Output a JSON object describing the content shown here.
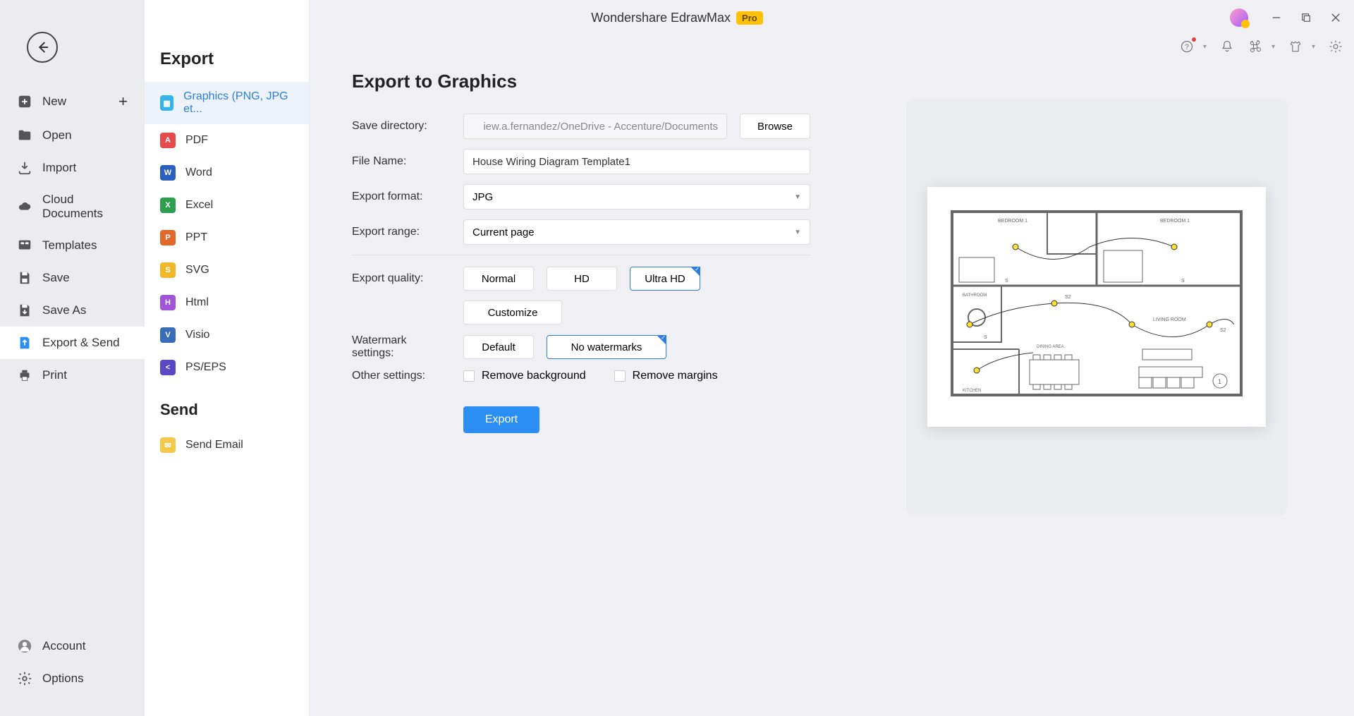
{
  "titlebar": {
    "title": "Wondershare EdrawMax",
    "badge": "Pro"
  },
  "nav": {
    "items": [
      {
        "label": "New",
        "has_plus": true
      },
      {
        "label": "Open"
      },
      {
        "label": "Import"
      },
      {
        "label": "Cloud Documents"
      },
      {
        "label": "Templates"
      },
      {
        "label": "Save"
      },
      {
        "label": "Save As"
      },
      {
        "label": "Export & Send"
      },
      {
        "label": "Print"
      }
    ],
    "bottom": [
      {
        "label": "Account"
      },
      {
        "label": "Options"
      }
    ]
  },
  "exportcol": {
    "heading_export": "Export",
    "heading_send": "Send",
    "items": [
      {
        "label": "Graphics (PNG, JPG et..."
      },
      {
        "label": "PDF"
      },
      {
        "label": "Word"
      },
      {
        "label": "Excel"
      },
      {
        "label": "PPT"
      },
      {
        "label": "SVG"
      },
      {
        "label": "Html"
      },
      {
        "label": "Visio"
      },
      {
        "label": "PS/EPS"
      }
    ],
    "send_items": [
      {
        "label": "Send Email"
      }
    ]
  },
  "form": {
    "heading": "Export to Graphics",
    "labels": {
      "save_dir": "Save directory:",
      "file_name": "File Name:",
      "format": "Export format:",
      "range": "Export range:",
      "quality": "Export quality:",
      "watermark": "Watermark settings:",
      "other": "Other settings:"
    },
    "save_dir_value": "iew.a.fernandez/OneDrive - Accenture/Documents",
    "browse": "Browse",
    "file_name_value": "House Wiring Diagram Template1",
    "format_value": "JPG",
    "range_value": "Current page",
    "quality_options": {
      "normal": "Normal",
      "hd": "HD",
      "ultra": "Ultra HD",
      "custom": "Customize"
    },
    "watermark_options": {
      "default": "Default",
      "none": "No watermarks"
    },
    "other_options": {
      "remove_bg": "Remove background",
      "remove_margins": "Remove margins"
    },
    "export_btn": "Export"
  },
  "preview": {
    "diagram_rooms": {
      "bed1": "BEDROOM 1",
      "bed2": "BEDROOM 1",
      "bath": "BATHROOM",
      "living": "LIVING ROOM",
      "dining": "DINING AREA",
      "kitchen": "KITCHEN"
    }
  }
}
